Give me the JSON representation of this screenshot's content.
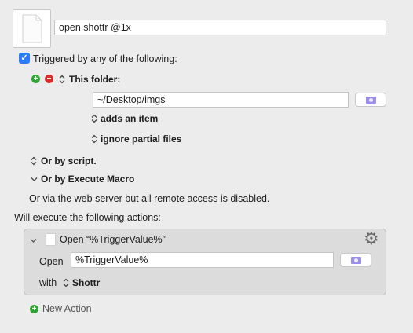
{
  "macro": {
    "name": "open shottr @1x"
  },
  "triggers": {
    "checkbox_label": "Triggered by any of the following:",
    "checked": true,
    "folder_trigger": {
      "add_symbol": "+",
      "remove_symbol": "−",
      "label": "This folder:",
      "path": "~/Desktop/imgs",
      "condition": "adds an item",
      "option": "ignore partial files"
    },
    "or_by_script": "Or by script.",
    "or_by_execute_macro": "Or by Execute Macro",
    "web_server_note": "Or via the web server but all remote access is disabled."
  },
  "actions": {
    "heading": "Will execute the following actions:",
    "items": [
      {
        "title": "Open “%TriggerValue%”",
        "open_label": "Open",
        "open_value": "%TriggerValue%",
        "with_label": "with",
        "with_app": "Shottr"
      }
    ],
    "new_action_label": "New Action"
  },
  "icons": {
    "doc": "document-icon",
    "gear": "gear-icon",
    "folder": "folder-icon",
    "updown": "up-down-chevron-icon",
    "disclosure": "chevron-down-icon"
  },
  "colors": {
    "checkbox": "#2b7cf6",
    "add": "#2fa334",
    "remove": "#d92b2b",
    "folder": "#9b8ee8"
  }
}
